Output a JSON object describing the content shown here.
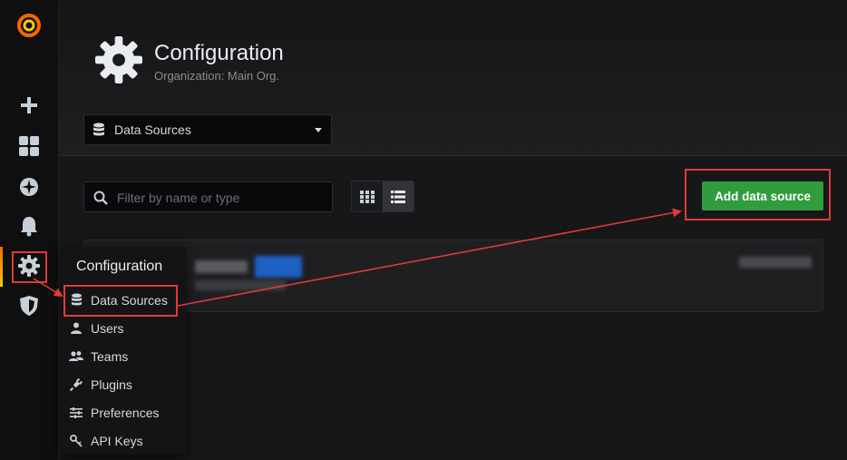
{
  "header": {
    "title": "Configuration",
    "subtitle": "Organization: Main Org."
  },
  "datasource_select": {
    "selected": "Data Sources",
    "icon": "database-icon"
  },
  "filter": {
    "placeholder": "Filter by name or type",
    "value": ""
  },
  "actions": {
    "add_label": "Add data source"
  },
  "menu": {
    "title": "Configuration",
    "items": [
      {
        "label": "Data Sources",
        "icon": "database-icon"
      },
      {
        "label": "Users",
        "icon": "user-icon"
      },
      {
        "label": "Teams",
        "icon": "users-icon"
      },
      {
        "label": "Plugins",
        "icon": "plug-icon"
      },
      {
        "label": "Preferences",
        "icon": "sliders-icon"
      },
      {
        "label": "API Keys",
        "icon": "key-icon"
      }
    ]
  },
  "sidebar": {
    "icons": [
      "grafana-logo",
      "plus-icon",
      "dashboards-icon",
      "explore-icon",
      "bell-icon",
      "gear-icon",
      "shield-icon"
    ]
  },
  "colors": {
    "accent": "#f46800",
    "add_button": "#2f9d3d",
    "highlight": "#e03a3a",
    "background": "#161719"
  }
}
